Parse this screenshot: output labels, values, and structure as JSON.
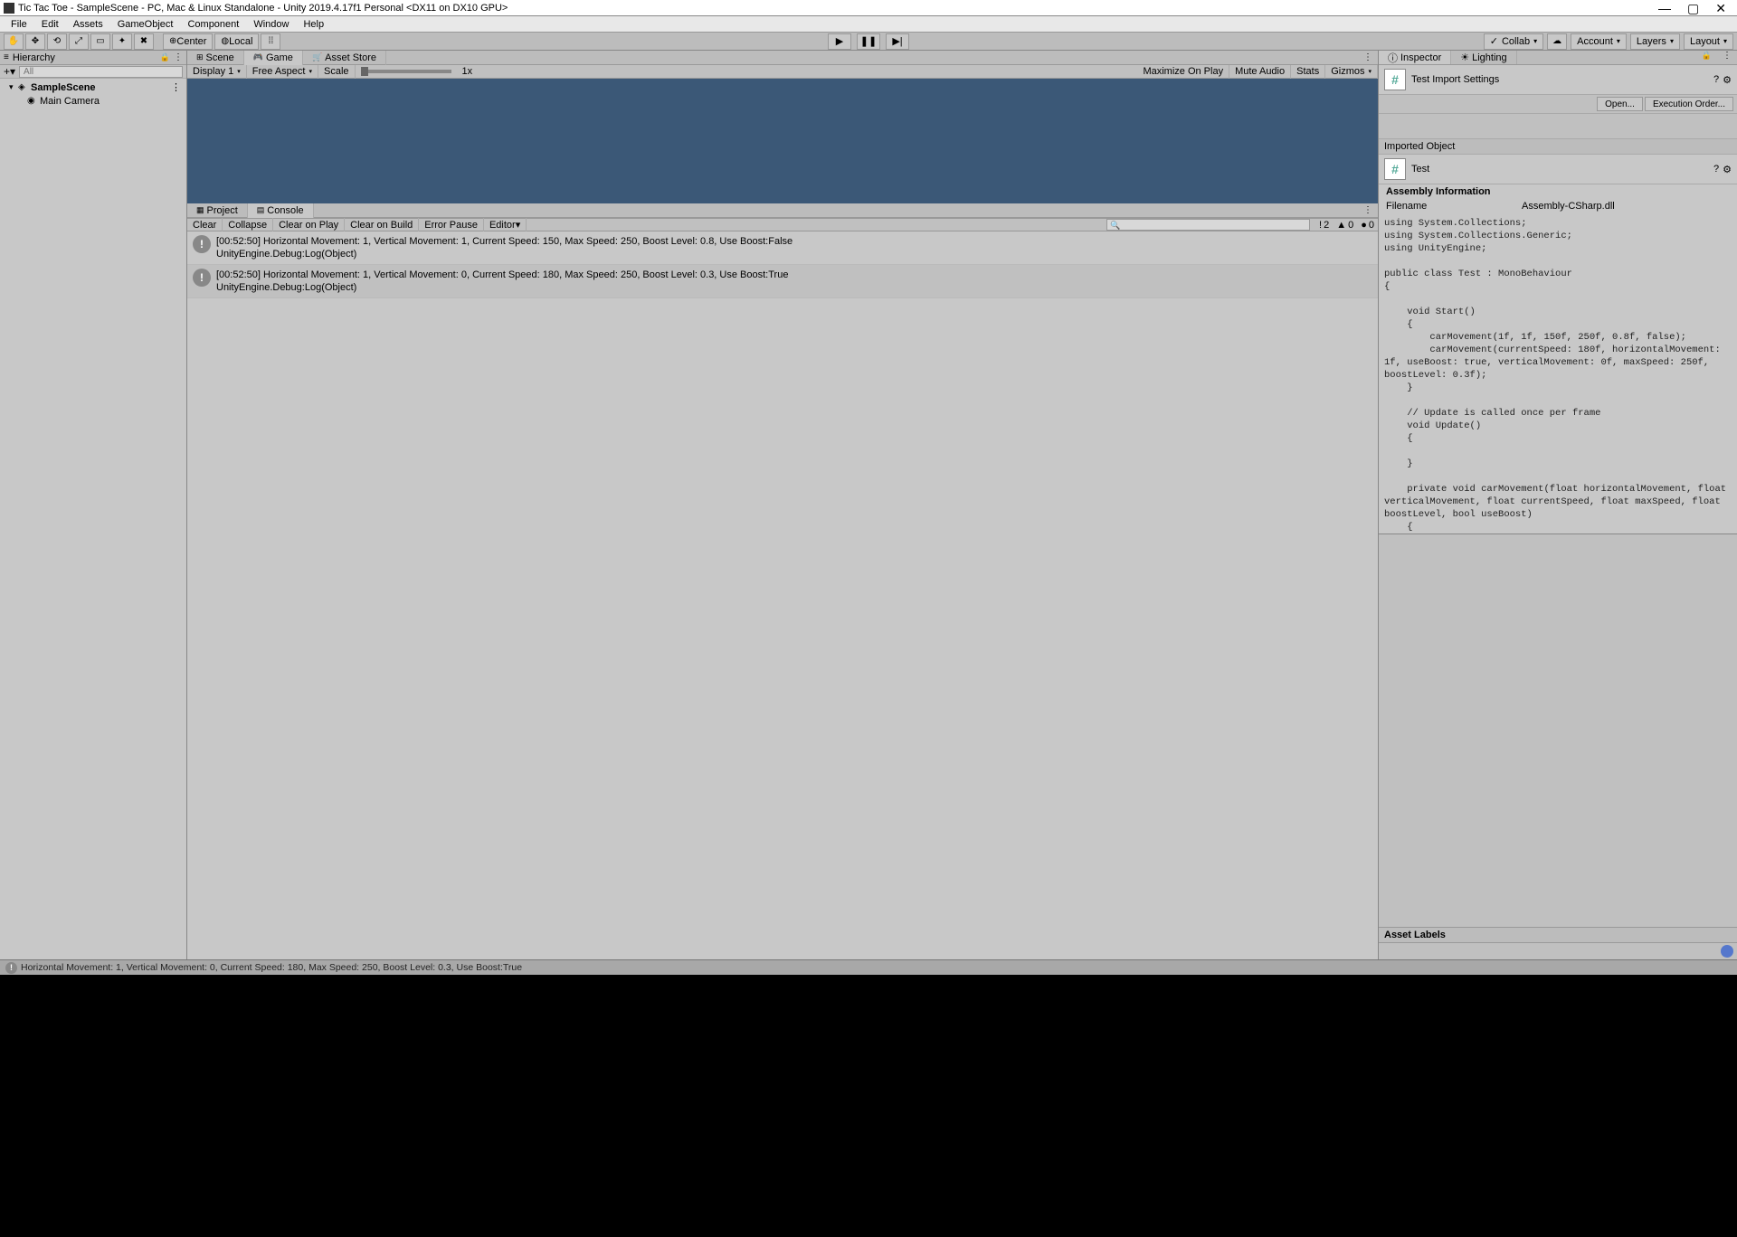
{
  "window": {
    "title": "Tic Tac Toe - SampleScene - PC, Mac & Linux Standalone - Unity 2019.4.17f1 Personal <DX11 on DX10 GPU>"
  },
  "menu": {
    "file": "File",
    "edit": "Edit",
    "assets": "Assets",
    "gameobject": "GameObject",
    "component": "Component",
    "window": "Window",
    "help": "Help"
  },
  "toolbar": {
    "center": "Center",
    "local": "Local",
    "collab": "Collab",
    "account": "Account",
    "layers": "Layers",
    "layout": "Layout"
  },
  "hierarchy": {
    "title": "Hierarchy",
    "search_placeholder": "All",
    "scene": "SampleScene",
    "items": [
      "Main Camera"
    ]
  },
  "center_tabs": {
    "scene": "Scene",
    "game": "Game",
    "asset_store": "Asset Store"
  },
  "game_toolbar": {
    "display": "Display 1",
    "aspect": "Free Aspect",
    "scale": "Scale",
    "scale_val": "1x",
    "maximize": "Maximize On Play",
    "mute": "Mute Audio",
    "stats": "Stats",
    "gizmos": "Gizmos"
  },
  "bottom_tabs": {
    "project": "Project",
    "console": "Console"
  },
  "console_toolbar": {
    "clear": "Clear",
    "collapse": "Collapse",
    "clear_play": "Clear on Play",
    "clear_build": "Clear on Build",
    "error_pause": "Error Pause",
    "editor": "Editor",
    "info_count": "2",
    "warn_count": "0",
    "err_count": "0"
  },
  "console_rows": [
    {
      "msg": "[00:52:50] Horizontal Movement: 1, Vertical Movement: 1, Current Speed: 150, Max Speed: 250, Boost Level: 0.8, Use Boost:False",
      "src": "UnityEngine.Debug:Log(Object)"
    },
    {
      "msg": "[00:52:50] Horizontal Movement: 1, Vertical Movement: 0, Current Speed: 180, Max Speed: 250, Boost Level: 0.3, Use Boost:True",
      "src": "UnityEngine.Debug:Log(Object)"
    }
  ],
  "inspector_tabs": {
    "inspector": "Inspector",
    "lighting": "Lighting"
  },
  "inspector": {
    "header_title": "Test Import Settings",
    "open": "Open...",
    "exec_order": "Execution Order...",
    "imported_object": "Imported Object",
    "test_label": "Test",
    "assembly_info": "Assembly Information",
    "filename_key": "Filename",
    "filename_val": "Assembly-CSharp.dll",
    "asset_labels": "Asset Labels",
    "code": "using System.Collections;\nusing System.Collections.Generic;\nusing UnityEngine;\n\npublic class Test : MonoBehaviour\n{\n\n    void Start()\n    {\n        carMovement(1f, 1f, 150f, 250f, 0.8f, false);\n        carMovement(currentSpeed: 180f, horizontalMovement: 1f, useBoost: true, verticalMovement: 0f, maxSpeed: 250f, boostLevel: 0.3f);\n    }\n\n    // Update is called once per frame\n    void Update()\n    {\n        \n    }\n\n    private void carMovement(float horizontalMovement, float verticalMovement, float currentSpeed, float maxSpeed, float boostLevel, bool useBoost)\n    {\n        Debug.Log(\"Horizontal Movement: \" + horizontalMovement + \", Vertical Movement: \" + verticalMovement + \", Current Speed: \" + currentSpeed +\n            \", Max Speed: \" + maxSpeed + \", Boost Level: \" + boostLevel + \", Use Boost:\" + useBoost);\n    }\n\n}"
  },
  "status": {
    "text": "Horizontal Movement: 1, Vertical Movement: 0, Current Speed: 180, Max Speed: 250, Boost Level: 0.3, Use Boost:True"
  }
}
